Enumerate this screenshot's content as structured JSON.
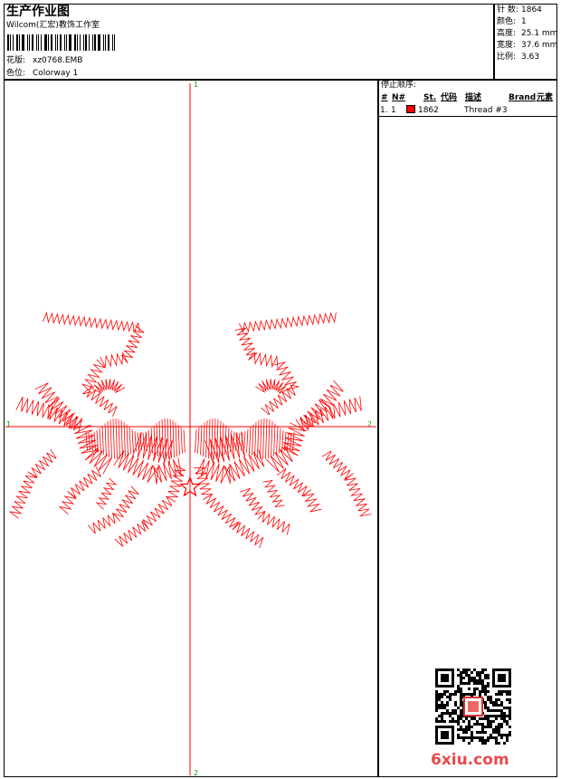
{
  "header": {
    "title": "生产作业图",
    "studio": "Wilcom(汇宏)教饰工作室",
    "design_label": "花版:",
    "design_value": "xz0768.EMB",
    "color_label": "色位:",
    "color_value": "Colorway 1"
  },
  "stats": [
    {
      "label": "针 数:",
      "value": "1864"
    },
    {
      "label": "颜色:",
      "value": "1"
    },
    {
      "label": "高度:",
      "value": "25.1 mm"
    },
    {
      "label": "宽度:",
      "value": "37.6 mm"
    },
    {
      "label": "比例:",
      "value": "3.63"
    }
  ],
  "stop_sequence": {
    "title": "停止顺序:",
    "columns": [
      "#",
      "N#",
      "St.",
      "代码",
      "描述",
      "Brand",
      "元素"
    ],
    "rows": [
      {
        "index": "1.",
        "n": "1",
        "code": "1862",
        "description": "Thread #3",
        "color": "#ff0000"
      }
    ]
  },
  "axes": {
    "top": "1",
    "bottom": "2",
    "left": "1",
    "right": "2"
  },
  "design_color": "#ff0000",
  "watermark": "6xiu.com"
}
